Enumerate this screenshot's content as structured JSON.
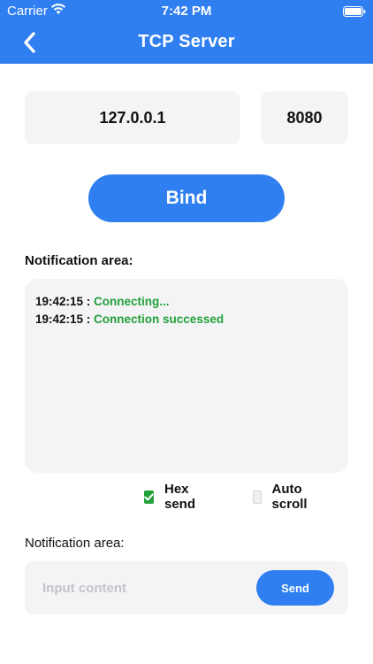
{
  "status_bar": {
    "carrier": "Carrier",
    "time": "7:42 PM",
    "icons": [
      "wifi-icon",
      "battery-icon"
    ]
  },
  "nav": {
    "title": "TCP Server",
    "back_icon": "chevron-left-icon"
  },
  "connection": {
    "ip": "127.0.0.1",
    "port": "8080",
    "bind_label": "Bind"
  },
  "log": {
    "label": "Notification area:",
    "lines": [
      {
        "time": "19:42:15",
        "sep": " : ",
        "message": "Connecting..."
      },
      {
        "time": "19:42:15",
        "sep": " : ",
        "message": "Connection successed"
      }
    ]
  },
  "options": {
    "hex_send": {
      "label": "Hex send",
      "checked": true
    },
    "auto_scroll": {
      "label": "Auto scroll",
      "checked": false
    }
  },
  "send": {
    "label": "Notification area:",
    "placeholder": "Input content",
    "value": "",
    "button_label": "Send"
  },
  "colors": {
    "accent": "#2f7ff0",
    "success": "#22a03a",
    "field_bg": "#f4f4f6"
  }
}
